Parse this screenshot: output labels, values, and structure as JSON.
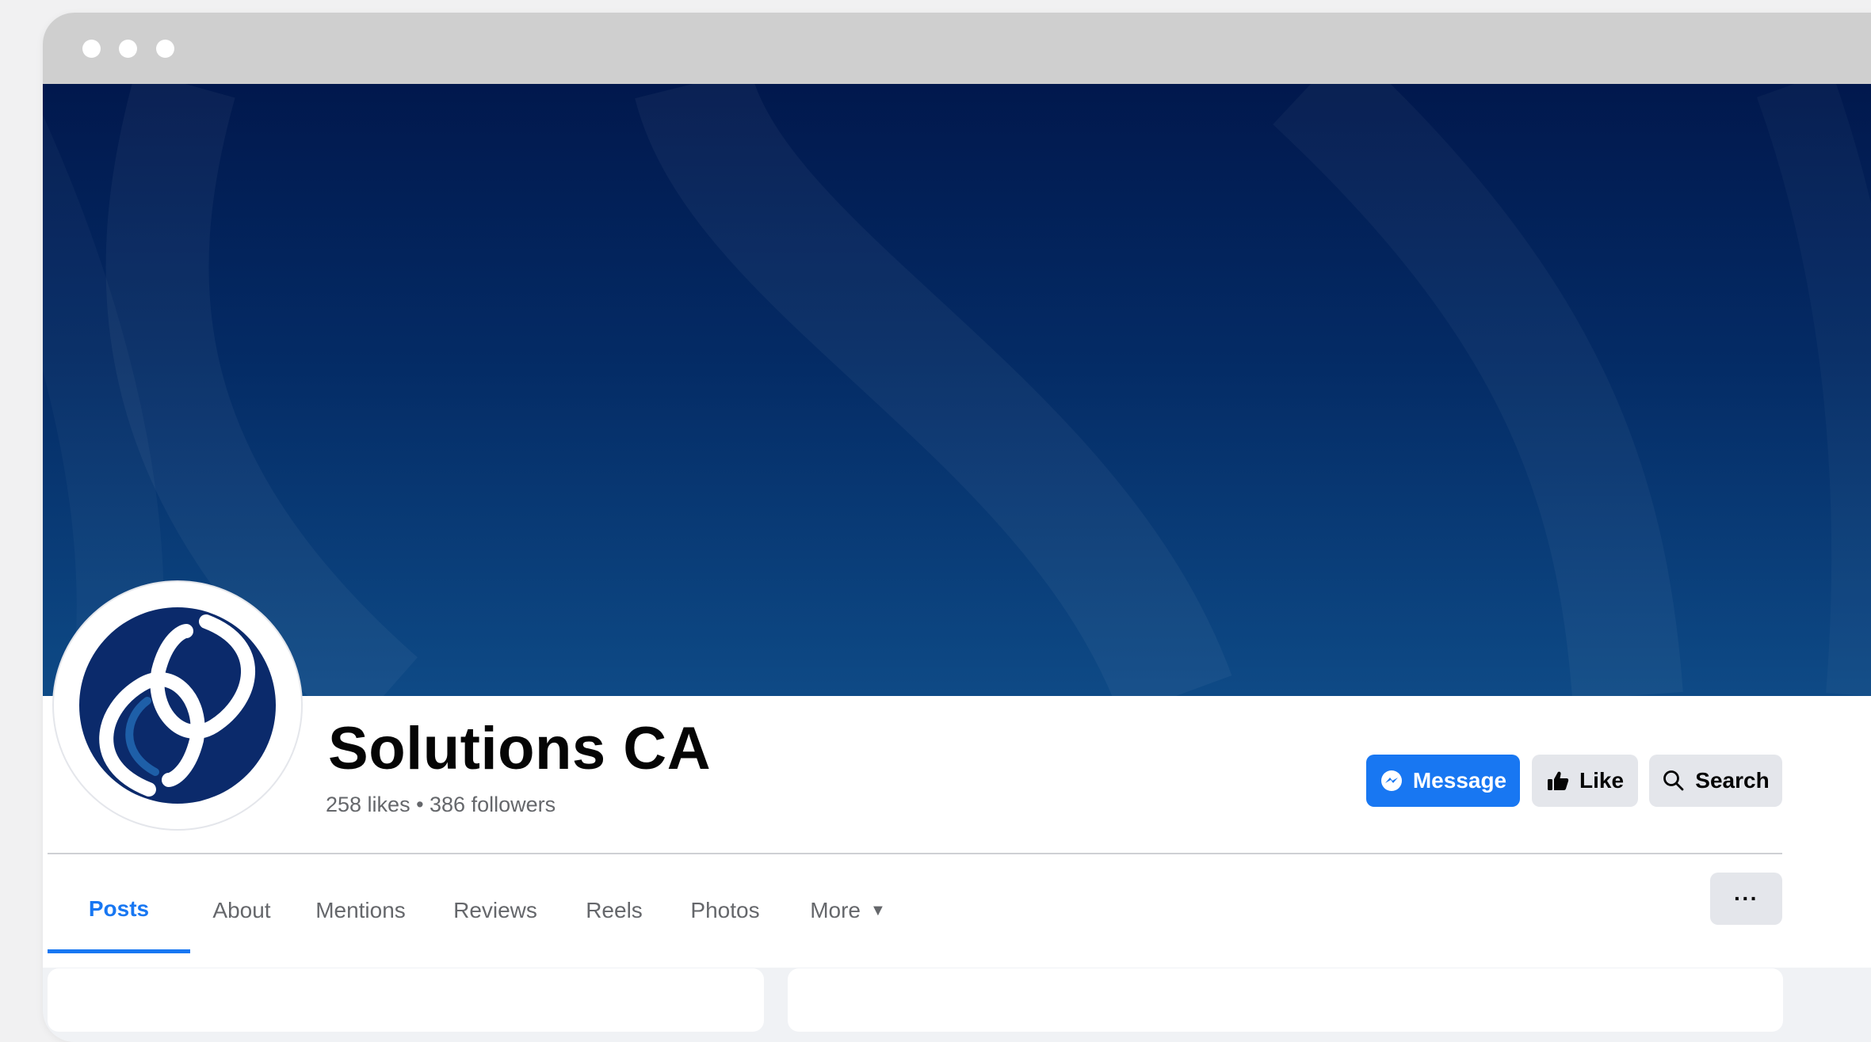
{
  "window": {
    "controls": [
      "close",
      "minimize",
      "maximize"
    ]
  },
  "page": {
    "name": "Solutions CA",
    "stats": "258 likes • 386 followers"
  },
  "actions": {
    "message_label": "Message",
    "like_label": "Like",
    "search_label": "Search",
    "more_options_label": "···"
  },
  "tabs": [
    {
      "label": "Posts",
      "active": true
    },
    {
      "label": "About",
      "active": false
    },
    {
      "label": "Mentions",
      "active": false
    },
    {
      "label": "Reviews",
      "active": false
    },
    {
      "label": "Reels",
      "active": false
    },
    {
      "label": "Photos",
      "active": false
    },
    {
      "label": "More",
      "active": false,
      "icon": "caret-down-icon"
    }
  ],
  "icons": {
    "message": "messenger-icon",
    "like": "thumbs-up-icon",
    "search": "search-icon",
    "logo": "solutions-s-logo"
  },
  "colors": {
    "accent": "#1877f2",
    "cover_top": "#01184d",
    "cover_bottom": "#0e4a86",
    "logo_navy": "#0b2a6b"
  }
}
